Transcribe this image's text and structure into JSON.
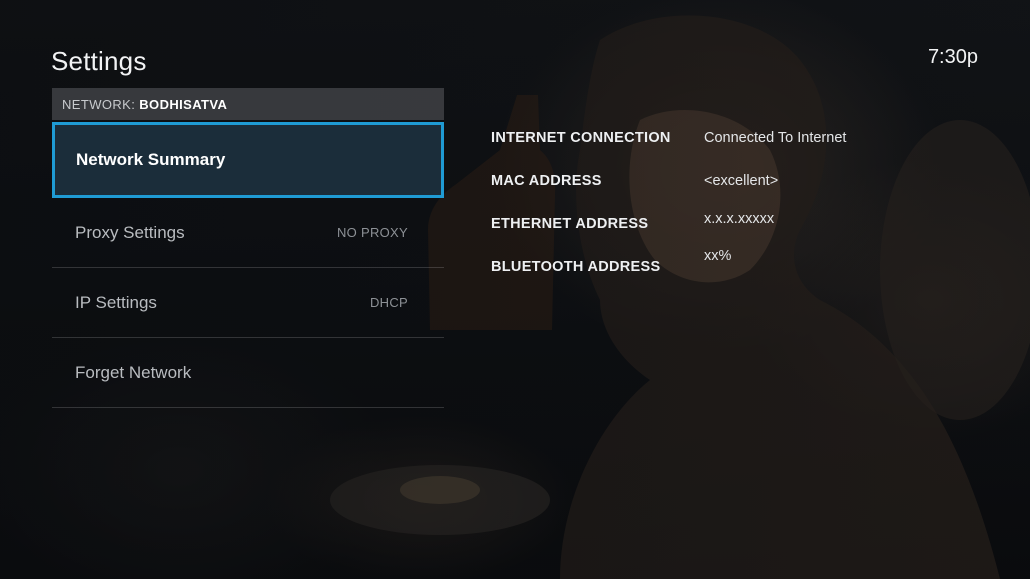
{
  "header": {
    "title": "Settings",
    "clock": "7:30p"
  },
  "network": {
    "prefix": "NETWORK:",
    "name": "BODHISATVA"
  },
  "menu": {
    "items": [
      {
        "label": "Network Summary",
        "value": "",
        "selected": true
      },
      {
        "label": "Proxy Settings",
        "value": "NO PROXY",
        "selected": false
      },
      {
        "label": "IP Settings",
        "value": "DHCP",
        "selected": false
      },
      {
        "label": "Forget Network",
        "value": "",
        "selected": false
      }
    ]
  },
  "summary": {
    "rows": [
      {
        "key": "INTERNET CONNECTION",
        "value": "Connected To Internet"
      },
      {
        "key": "MAC ADDRESS",
        "value": "<excellent>"
      },
      {
        "key": "ETHERNET ADDRESS",
        "value": "x.x.x.xxxxx"
      },
      {
        "key": "BLUETOOTH ADDRESS",
        "value": "xx%"
      }
    ]
  },
  "colors": {
    "focus_border": "#1f9bd4",
    "focus_fill": "#1b2d3a"
  }
}
